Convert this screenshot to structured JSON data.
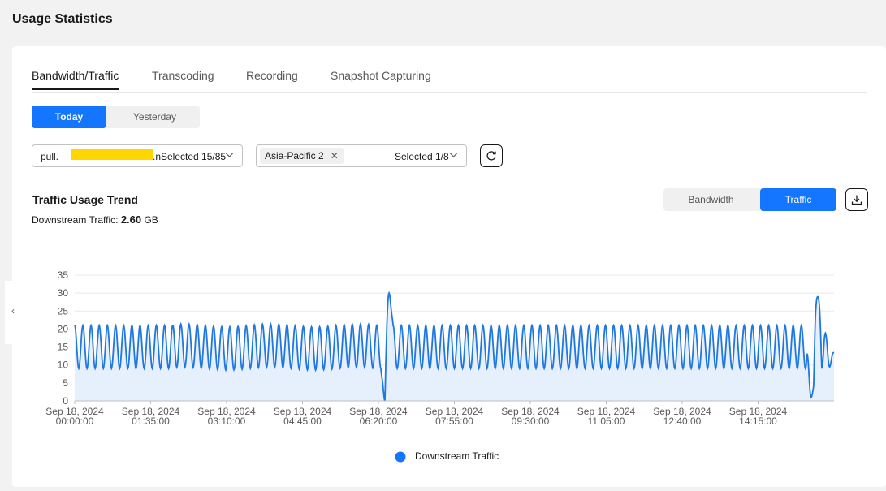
{
  "page": {
    "title": "Usage Statistics"
  },
  "tabs": [
    {
      "label": "Bandwidth/Traffic",
      "active": true
    },
    {
      "label": "Transcoding",
      "active": false
    },
    {
      "label": "Recording",
      "active": false
    },
    {
      "label": "Snapshot Capturing",
      "active": false
    }
  ],
  "day_toggle": {
    "today": "Today",
    "yesterday": "Yesterday",
    "selected": "Today"
  },
  "filters": {
    "stream_select": {
      "value_prefix": "pull.",
      "value_suffix": ".n",
      "selected_text": "Selected 15/85"
    },
    "region_select": {
      "tag": "Asia-Pacific 2",
      "selected_text": "Selected 1/8"
    }
  },
  "section": {
    "title": "Traffic Usage Trend",
    "summary_label": "Downstream Traffic: ",
    "summary_value": "2.60",
    "summary_unit": " GB"
  },
  "metric_toggle": {
    "bandwidth": "Bandwidth",
    "traffic": "Traffic",
    "selected": "Traffic"
  },
  "colors": {
    "accent": "#1476ff",
    "line": "#1f77e0",
    "area": "#e6f0fd",
    "redaction": "#ffd600"
  },
  "icons": {
    "refresh": "refresh-icon",
    "download": "download-icon",
    "chevron": "chevron-down-icon",
    "collapse": "chevron-left-icon"
  },
  "chart_data": {
    "type": "area",
    "ylim": [
      0,
      35
    ],
    "y_ticks": [
      0,
      5,
      10,
      15,
      20,
      25,
      30,
      35
    ],
    "x_ticks": [
      {
        "date": "Sep 18, 2024",
        "time": "00:00:00"
      },
      {
        "date": "Sep 18, 2024",
        "time": "01:35:00"
      },
      {
        "date": "Sep 18, 2024",
        "time": "03:10:00"
      },
      {
        "date": "Sep 18, 2024",
        "time": "04:45:00"
      },
      {
        "date": "Sep 18, 2024",
        "time": "06:20:00"
      },
      {
        "date": "Sep 18, 2024",
        "time": "07:55:00"
      },
      {
        "date": "Sep 18, 2024",
        "time": "09:30:00"
      },
      {
        "date": "Sep 18, 2024",
        "time": "11:05:00"
      },
      {
        "date": "Sep 18, 2024",
        "time": "12:40:00"
      },
      {
        "date": "Sep 18, 2024",
        "time": "14:15:00"
      }
    ],
    "x_range_minutes": [
      0,
      930
    ],
    "grid": true,
    "legend_position": "bottom",
    "series": [
      {
        "name": "Downstream Traffic",
        "period_minutes": 10,
        "peak": 21,
        "trough": 9,
        "spikes": [
          {
            "minute": 380,
            "value": 0
          },
          {
            "minute": 385,
            "value": 30
          },
          {
            "minute": 902,
            "value": 1
          },
          {
            "minute": 910,
            "value": 29
          }
        ],
        "end_value": 13.5
      }
    ]
  }
}
